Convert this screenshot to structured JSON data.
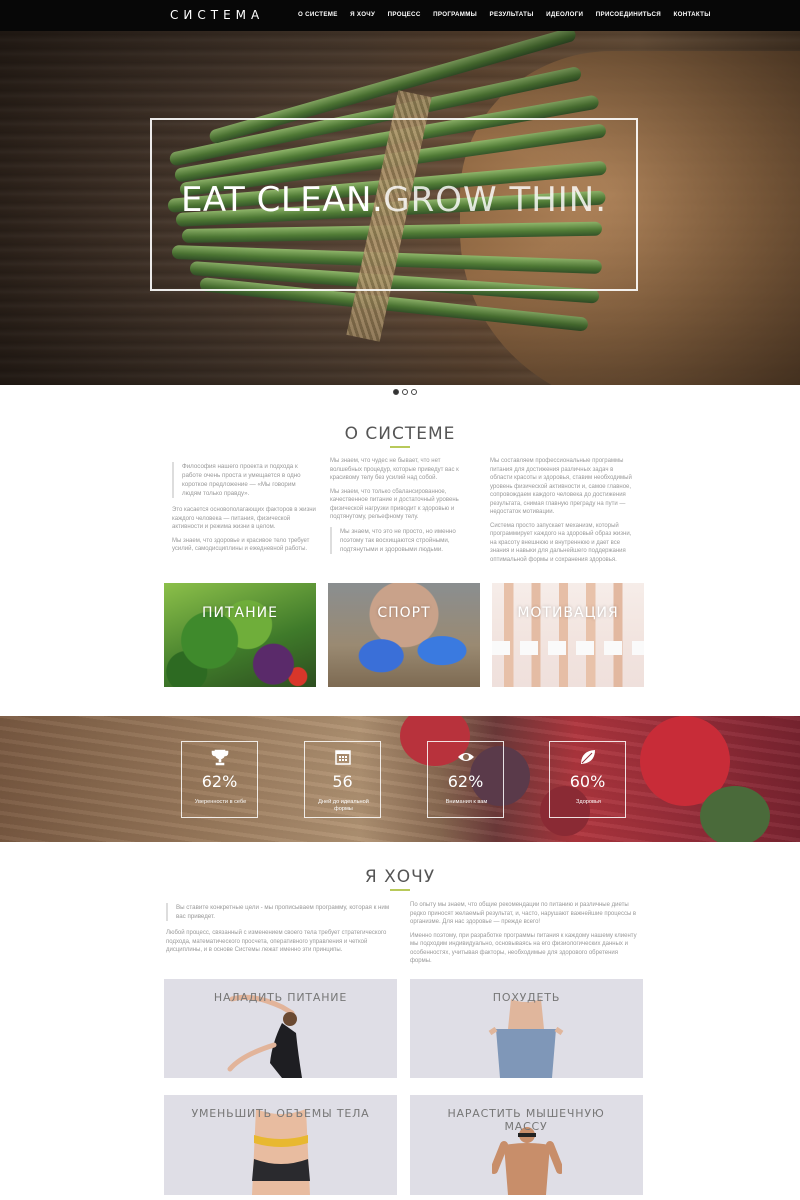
{
  "nav": {
    "logo": "СИСТЕМА",
    "items": [
      "О СИСТЕМЕ",
      "Я ХОЧУ",
      "ПРОЦЕСС",
      "ПРОГРАММЫ",
      "РЕЗУЛЬТАТЫ",
      "ИДЕОЛОГИ",
      "ПРИСОЕДИНИТЬСЯ",
      "КОНТАКТЫ"
    ]
  },
  "hero": {
    "title_bold": "EAT CLEAN.",
    "title_thin": "GROW THIN."
  },
  "about": {
    "title": "О СИСТЕМЕ",
    "col1_quote": "Философия нашего проекта и подхода к работе очень проста и умещается в одно короткое предложение — «Мы говорим людям только правду».",
    "col1_p1": "Это касается основополагающих факторов в жизни каждого человека — питания, физической активности и режима жизни в целом.",
    "col1_p2": "Мы знаем, что здоровье и красивое тело требует усилий, самодисциплины и ежедневной работы.",
    "col2_p1": "Мы знаем, что чудес не бывает, что нет волшебных процедур, которые приведут вас к красивому телу без усилий над собой.",
    "col2_p2": "Мы знаем, что только сбалансированное, качественное питание и достаточный уровень физической нагрузки приводит к здоровью и подтянутому, рельефному телу.",
    "col2_quote": "Мы знаем, что это не просто, но именно поэтому так восхищаются стройными, подтянутыми и здоровыми людьми.",
    "col3_p1": "Мы составляем профессиональные программы питания для достижения различных задач в области красоты и здоровья, ставим необходимый уровень физической активности и, самое главное, сопровождаем каждого человека до достижения результата, снимая главную преграду на пути — недостаток мотивации.",
    "col3_p2": "Система просто запускает механизм, который программирует каждого на здоровый образ жизни, на красоту внешнюю и внутреннюю и дает все знания и навыки для дальнейшего поддержания оптимальной формы и сохранения здоровья."
  },
  "tiles": [
    "ПИТАНИЕ",
    "СПОРТ",
    "МОТИВАЦИЯ"
  ],
  "stats": [
    {
      "icon": "trophy-icon",
      "value": "62%",
      "label": "Уверенности в себе"
    },
    {
      "icon": "calendar-icon",
      "value": "56",
      "label": "Дней до идеальной формы"
    },
    {
      "icon": "eye-icon",
      "value": "62%",
      "label": "Внимания к вам"
    },
    {
      "icon": "leaf-icon",
      "value": "60%",
      "label": "Здоровья"
    }
  ],
  "want": {
    "title": "Я ХОЧУ",
    "left_quote": "Вы ставите конкретные цели - мы прописываем программу, которая к ним вас приведет.",
    "left_p": "Любой процесс, связанный с изменением своего тела требует стратегического подхода, математического просчета, оперативного управления и четкой дисциплины, и в основе Системы лежат именно эти принципы.",
    "right_p1": "По опыту мы знаем, что общие рекомендации по питанию и различные диеты редко приносят желаемый результат, и, часто, нарушают важнейшие процессы в организме. Для нас здоровье — прежде всего!",
    "right_p2": "Именно поэтому, при разработке программы питания к каждому нашему клиенту мы подходим индивидуально, основываясь на его физиологических данных и особенностях, учитывая факторы, необходимые для здорового обретения формы.",
    "cards": [
      "НАЛАДИТЬ ПИТАНИЕ",
      "ПОХУДЕТЬ",
      "УМЕНЬШИТЬ ОБЪЕМЫ ТЕЛА",
      "НАРАСТИТЬ МЫШЕЧНУЮ МАССУ"
    ]
  }
}
